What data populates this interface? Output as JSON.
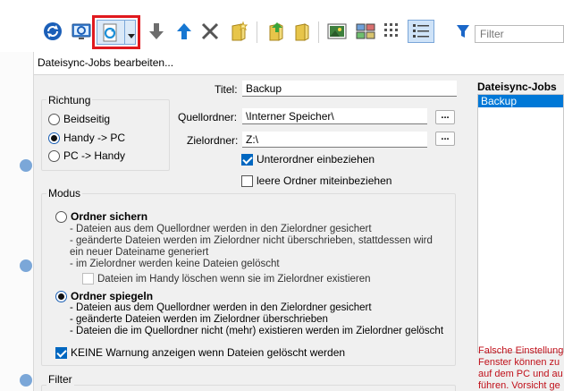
{
  "toolbar": {
    "filter_placeholder": "Filter"
  },
  "dialog": {
    "title": "Dateisync-Jobs bearbeiten...",
    "direction": {
      "label": "Richtung",
      "options": [
        "Beidseitig",
        "Handy -> PC",
        "PC -> Handy"
      ],
      "selected": "Handy -> PC"
    },
    "title_label": "Titel:",
    "title_value": "Backup",
    "source_label": "Quellordner:",
    "source_value": "\\Interner Speicher\\",
    "target_label": "Zielordner:",
    "target_value": "Z:\\",
    "browse_label": "...",
    "include_subfolders": {
      "label": "Unterordner einbeziehen",
      "checked": true
    },
    "include_empty": {
      "label": "leere Ordner miteinbeziehen",
      "checked": false
    },
    "mode": {
      "label": "Modus",
      "backup": {
        "label": "Ordner sichern",
        "lines": [
          "- Dateien aus dem Quellordner werden in den Zielordner gesichert",
          "- geänderte Dateien werden im Zielordner nicht überschrieben, stattdessen wird",
          "ein neuer Dateiname generiert",
          "- im Zielordner werden keine Dateien gelöscht"
        ],
        "delete_on_phone": "Dateien im Handy löschen wenn sie im Zielordner existieren"
      },
      "mirror": {
        "label": "Ordner spiegeln",
        "lines": [
          "- Dateien aus dem Quellordner werden in den Zielordner gesichert",
          "- geänderte Dateien werden im Zielordner überschrieben",
          "- Dateien die im Quellordner nicht (mehr) existieren werden im Zielordner gelöscht"
        ]
      },
      "selected": "Ordner spiegeln",
      "no_warning": {
        "label": "KEINE Warnung anzeigen wenn Dateien gelöscht werden",
        "checked": true
      }
    },
    "filter_label": "Filter",
    "jobs": {
      "label": "Dateisync-Jobs",
      "items": [
        "Backup"
      ],
      "selected": "Backup"
    },
    "warning_lines": [
      "Falsche Einstellung",
      "Fenster können zu",
      "auf dem PC und au",
      "führen. Vorsicht ge"
    ]
  },
  "colors": {
    "accent": "#0078d7",
    "highlight_border": "#e0191e",
    "warning": "#c0101a"
  }
}
